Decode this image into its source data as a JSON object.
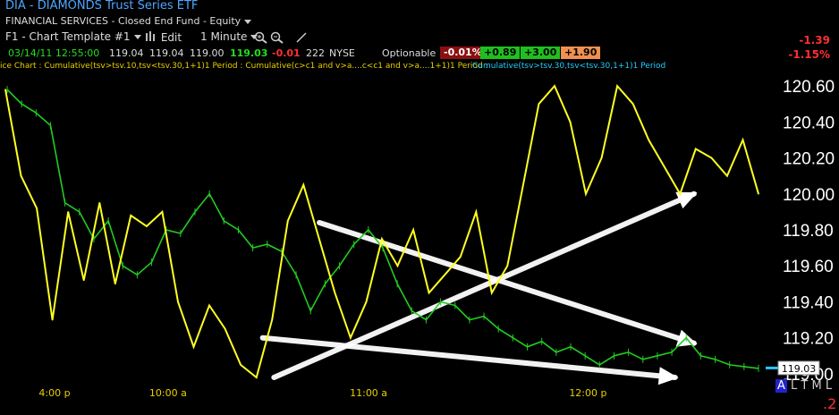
{
  "header": {
    "symbol": "DIA",
    "dash": " - ",
    "name": "DIAMONDS Trust Series ETF",
    "category": "FINANCIAL SERVICES - Closed End Fund - Equity",
    "template": "F1 - Chart Template #1",
    "edit_label": "Edit",
    "interval": "1 Minute",
    "quote": {
      "datetime": "03/14/11 12:55:00",
      "open": "119.04",
      "high": "119.04",
      "low": "119.00",
      "last": "119.03",
      "change": "-0.01",
      "volume": "222",
      "exchange": "NYSE",
      "optionable": "Optionable",
      "pct_change": "-0.01%",
      "box2": "+0.89",
      "box3": "+3.00",
      "box4": "+1.90"
    },
    "right_change": "-1.39",
    "right_pct": "-1.15%"
  },
  "legend": {
    "seg1": "ice Chart : Cumulative(tsv>tsv.10,tsv<tsv.30,1+1)1 Period : Cumulative(c>c1 and v>a....c<c1 and v>a....1+1)1 Period : ",
    "seg2": "Cumulative(tsv>tsv.30,tsv<tsv.30,1+1)1 Period"
  },
  "footer": {
    "mode_active": "A",
    "modes": "L T M L",
    "corner": ".2"
  },
  "colors": {
    "price": "#22cc22",
    "indicator": "#ffff22",
    "arrows": "#ffffff",
    "axis_text": "#ffffff",
    "time_text": "#e8d000",
    "last_tag": "#ffffff",
    "neg": "#ff3030"
  },
  "chart_data": {
    "type": "line",
    "title": "",
    "x": [
      "4:00 p",
      "10:00 a",
      "11:00 a",
      "12:00 p"
    ],
    "y_ticks": [
      "120.60",
      "120.40",
      "120.20",
      "120.00",
      "119.80",
      "119.60",
      "119.40",
      "119.20",
      "119.00"
    ],
    "ylim": [
      118.95,
      120.65
    ],
    "last_price_label": "119.03",
    "grid": false,
    "series": [
      {
        "name": "",
        "kind": "price",
        "values": [
          120.58,
          120.5,
          120.45,
          120.38,
          119.95,
          119.9,
          119.75,
          119.85,
          119.6,
          119.55,
          119.62,
          119.8,
          119.78,
          119.9,
          120.0,
          119.85,
          119.8,
          119.7,
          119.72,
          119.68,
          119.55,
          119.35,
          119.5,
          119.6,
          119.72,
          119.8,
          119.7,
          119.5,
          119.35,
          119.3,
          119.4,
          119.38,
          119.3,
          119.32,
          119.25,
          119.2,
          119.15,
          119.18,
          119.12,
          119.15,
          119.1,
          119.05,
          119.1,
          119.12,
          119.08,
          119.1,
          119.12,
          119.2,
          119.1,
          119.08,
          119.05,
          119.04,
          119.03
        ]
      },
      {
        "name": "",
        "kind": "indicator",
        "values": [
          120.58,
          120.1,
          119.92,
          119.3,
          119.9,
          119.52,
          119.95,
          119.5,
          119.88,
          119.82,
          119.9,
          119.4,
          119.15,
          119.38,
          119.25,
          119.05,
          118.98,
          119.3,
          119.85,
          120.05,
          119.75,
          119.45,
          119.2,
          119.4,
          119.75,
          119.6,
          119.8,
          119.45,
          119.55,
          119.65,
          119.9,
          119.45,
          119.6,
          120.05,
          120.5,
          120.6,
          120.4,
          120.0,
          120.2,
          120.6,
          120.5,
          120.3,
          120.15,
          120.0,
          120.25,
          120.2,
          120.1,
          120.3,
          120.0
        ]
      }
    ],
    "trendlines": [
      {
        "x0": 0.355,
        "y0": 118.98,
        "x1": 0.91,
        "y1": 120.0
      },
      {
        "x0": 0.415,
        "y0": 119.84,
        "x1": 0.91,
        "y1": 119.17
      },
      {
        "x0": 0.34,
        "y0": 119.2,
        "x1": 0.885,
        "y1": 118.98
      }
    ]
  }
}
